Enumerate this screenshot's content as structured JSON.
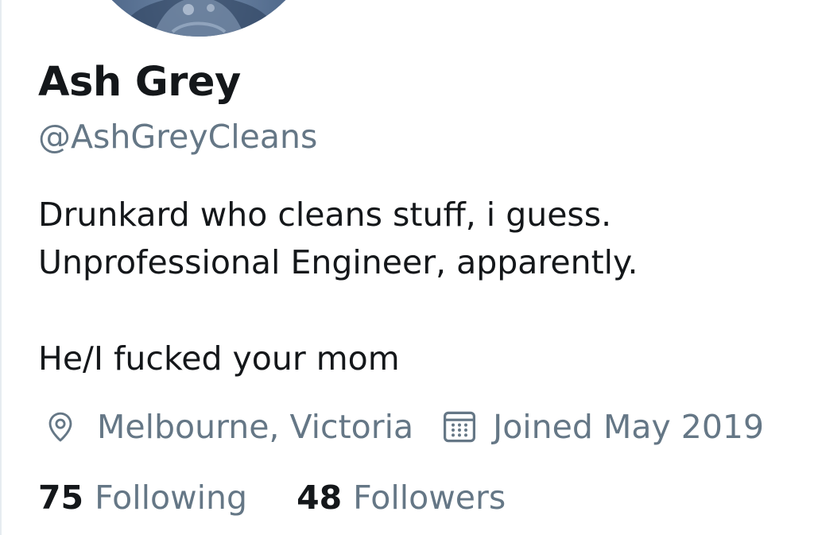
{
  "profile": {
    "name": "Ash Grey",
    "handle": "@AshGreyCleans",
    "bio": {
      "line1": "Drunkard who cleans stuff, i guess.",
      "line2": "Unprofessional Engineer, apparently.",
      "line3": "He/I fucked your mom"
    },
    "location": "Melbourne, Victoria",
    "joined": "Joined May 2019",
    "following_count": "75",
    "following_label": "Following",
    "followers_count": "48",
    "followers_label": "Followers"
  },
  "icons": {
    "location": "location-pin-icon",
    "joined": "calendar-icon"
  },
  "colors": {
    "text_primary": "#14171a",
    "text_secondary": "#657786",
    "avatar_tint": "#4e6789"
  }
}
